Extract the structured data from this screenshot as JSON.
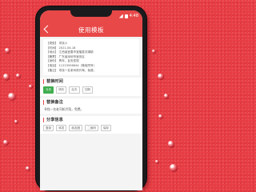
{
  "header": {
    "title": "使用模板",
    "status_time": "4:48"
  },
  "info_card": {
    "lines": [
      "【类型】 寻找人",
      "【时间】 2021-04-18",
      "【地点】 江西省宜春市宜福县洪湖镇",
      "【籍贯】 广东省深圳市宝安区",
      "【身份】 青年，且安发现",
      "【电话】 11223556644（微信同号）",
      "【备注】 寻找一名老司机代驾，免费。"
    ]
  },
  "replace_time": {
    "title": "替换时间",
    "options": [
      "今天",
      "明天",
      "后天",
      "日期"
    ],
    "selected": "今天"
  },
  "replace_note": {
    "title": "替换备注",
    "value": "寻找一名老司机代驾，免费。"
  },
  "share": {
    "title": "分享信息",
    "options": [
      "复制",
      "转发",
      "朋友圈",
      "二维码",
      "保存"
    ]
  },
  "colors": {
    "accent": "#e84848",
    "selected_chip": "#3fae4f",
    "background": "#e83c43"
  }
}
